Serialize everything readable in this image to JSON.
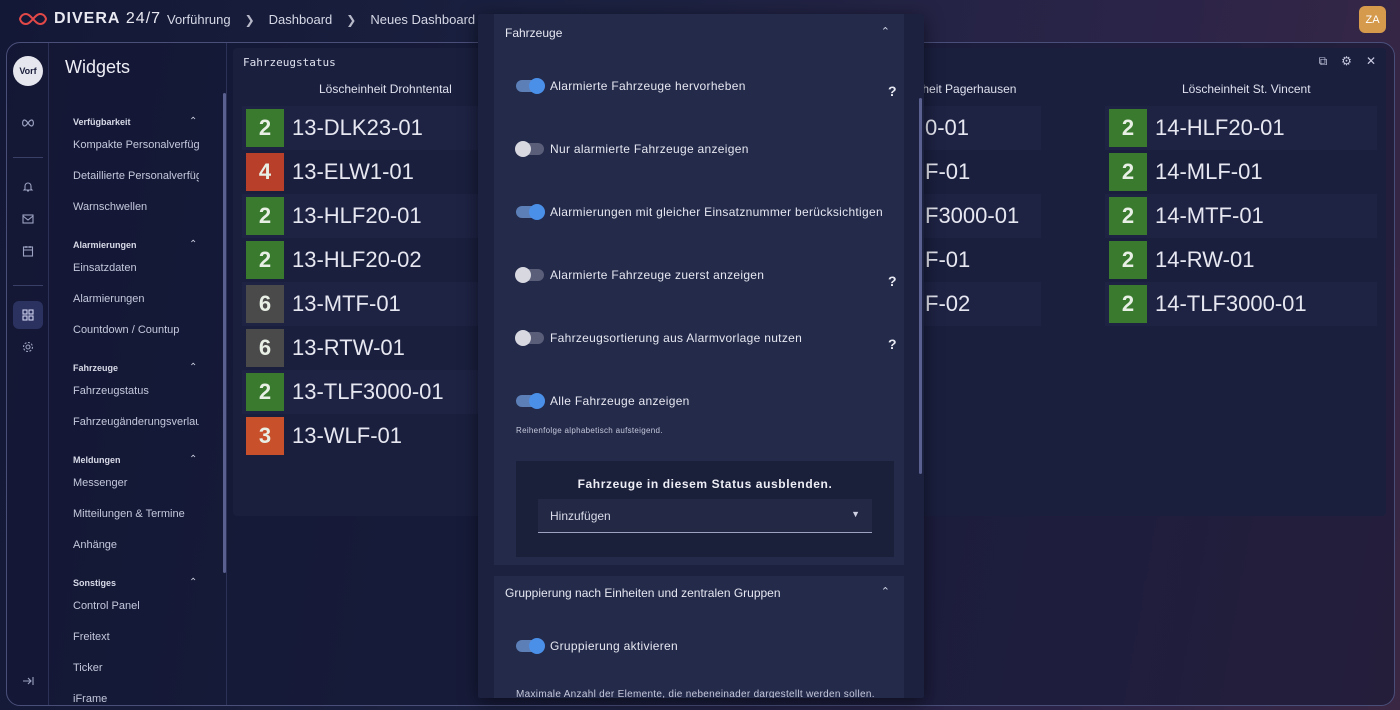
{
  "app": {
    "logo_text": "DIVERA",
    "logo_suffix": "24/7"
  },
  "breadcrumbs": [
    "Vorführung",
    "Dashboard",
    "Neues Dashboard"
  ],
  "user_initials": "ZA",
  "rail": {
    "avatar": "Vorf",
    "icons": [
      "infinity-icon",
      "bell-icon",
      "mail-icon",
      "calendar-icon",
      "dashboard-icon",
      "settings-icon",
      "collapse-icon"
    ]
  },
  "sidebar": {
    "title": "Widgets",
    "sections": [
      {
        "title": "Verfügbarkeit",
        "items": [
          "Kompakte Personalverfügbarkeit",
          "Detaillierte Personalverfügbarkeit",
          "Warnschwellen"
        ]
      },
      {
        "title": "Alarmierungen",
        "items": [
          "Einsatzdaten",
          "Alarmierungen",
          "Countdown / Countup"
        ]
      },
      {
        "title": "Fahrzeuge",
        "items": [
          "Fahrzeugstatus",
          "Fahrzeugänderungsverlauf"
        ]
      },
      {
        "title": "Meldungen",
        "items": [
          "Messenger",
          "Mitteilungen & Termine",
          "Anhänge"
        ]
      },
      {
        "title": "Sonstiges",
        "items": [
          "Control Panel",
          "Freitext",
          "Ticker",
          "iFrame"
        ]
      }
    ]
  },
  "widget": {
    "title": "Fahrzeugstatus",
    "columns": [
      {
        "header": "Löscheinheit Drohntental",
        "vehicles": [
          {
            "status": "2",
            "name": "13-DLK23-01",
            "color": "#3a7a2e"
          },
          {
            "status": "4",
            "name": "13-ELW1-01",
            "color": "#b8402a"
          },
          {
            "status": "2",
            "name": "13-HLF20-01",
            "color": "#3a7a2e"
          },
          {
            "status": "2",
            "name": "13-HLF20-02",
            "color": "#3a7a2e"
          },
          {
            "status": "6",
            "name": "13-MTF-01",
            "color": "#4a4a4a"
          },
          {
            "status": "6",
            "name": "13-RTW-01",
            "color": "#4a4a4a"
          },
          {
            "status": "2",
            "name": "13-TLF3000-01",
            "color": "#3a7a2e"
          },
          {
            "status": "3",
            "name": "13-WLF-01",
            "color": "#c8502a"
          }
        ]
      },
      {
        "header": "inheit Pagerhausen",
        "vehicles": [
          "0-01",
          "F-01",
          "F3000-01",
          "F-01",
          "F-02"
        ]
      },
      {
        "header": "Löscheinheit St. Vincent",
        "vehicles": [
          {
            "status": "2",
            "name": "14-HLF20-01",
            "color": "#3a7a2e"
          },
          {
            "status": "2",
            "name": "14-MLF-01",
            "color": "#3a7a2e"
          },
          {
            "status": "2",
            "name": "14-MTF-01",
            "color": "#3a7a2e"
          },
          {
            "status": "2",
            "name": "14-RW-01",
            "color": "#3a7a2e"
          },
          {
            "status": "2",
            "name": "14-TLF3000-01",
            "color": "#3a7a2e"
          }
        ]
      }
    ]
  },
  "modal": {
    "section1": {
      "title": "Fahrzeuge",
      "toggles": [
        {
          "label": "Alarmierte Fahrzeuge hervorheben",
          "on": true,
          "help": "?"
        },
        {
          "label": "Nur alarmierte Fahrzeuge anzeigen",
          "on": false,
          "help": ""
        },
        {
          "label": "Alarmierungen mit gleicher Einsatznummer berücksichtigen",
          "on": true,
          "help": ""
        },
        {
          "label": "Alarmierte Fahrzeuge zuerst anzeigen",
          "on": false,
          "help": "?"
        },
        {
          "label": "Fahrzeugsortierung aus Alarmvorlage nutzen",
          "on": false,
          "help": "?"
        },
        {
          "label": "Alle Fahrzeuge anzeigen",
          "on": true,
          "help": ""
        }
      ],
      "hint": "Reihenfolge alphabetisch aufsteigend.",
      "status_box_title": "Fahrzeuge in diesem Status ausblenden.",
      "select_value": "Hinzufügen"
    },
    "section2": {
      "title": "Gruppierung nach Einheiten und zentralen Gruppen",
      "toggle_label": "Gruppierung aktivieren",
      "hint": "Maximale Anzahl der Elemente, die nebeneinader dargestellt werden sollen."
    }
  }
}
